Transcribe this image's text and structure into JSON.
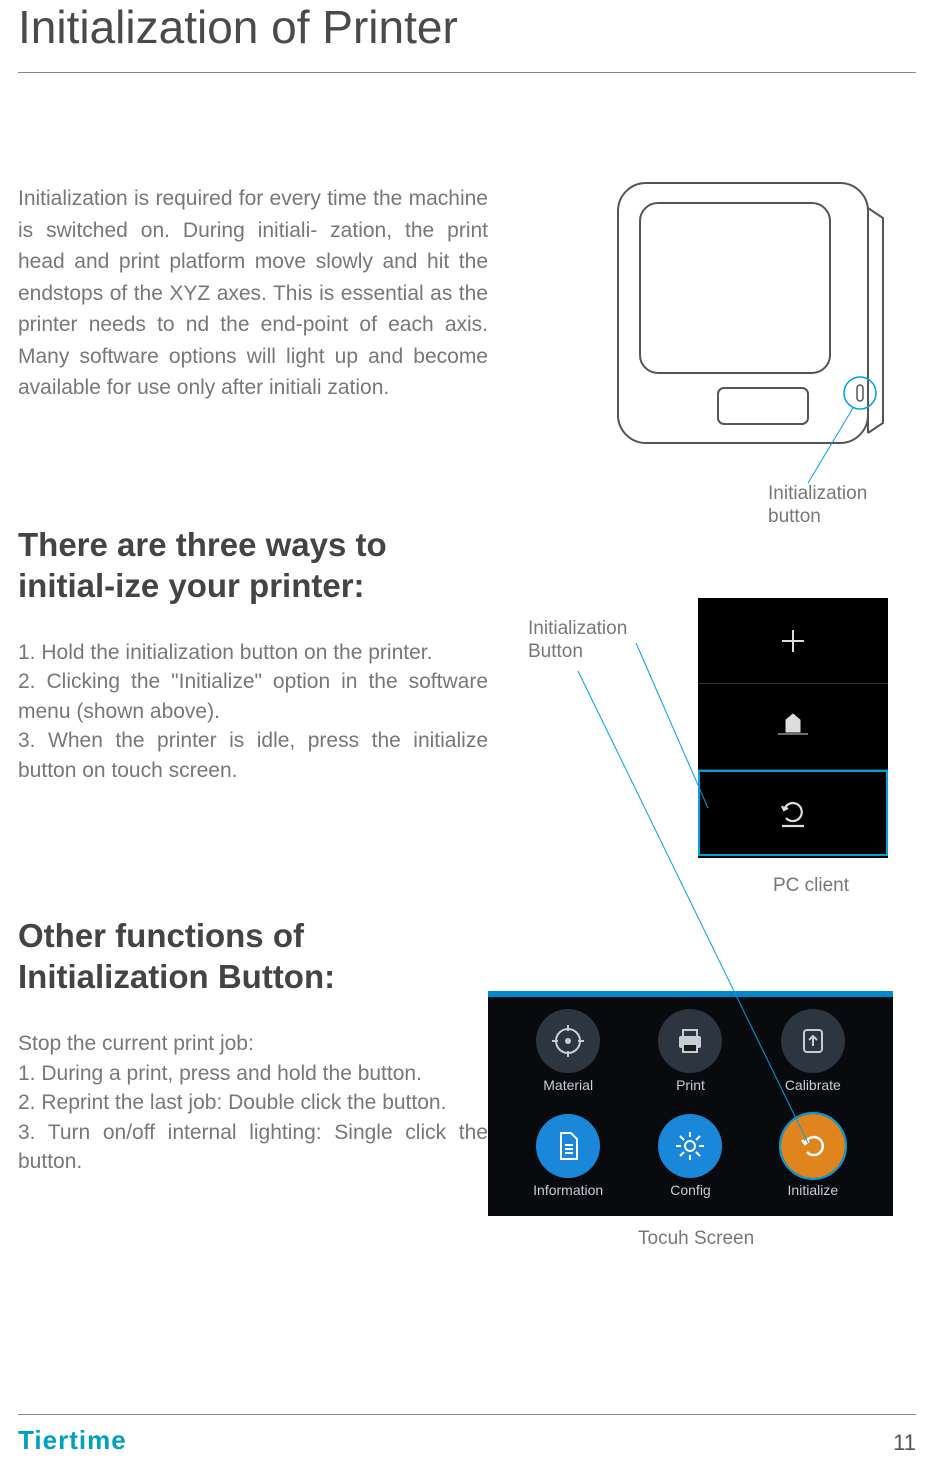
{
  "title": "Initialization of Printer",
  "intro": "Initialization is required for every time the machine is switched on. During initiali- zation, the print head and print platform move slowly and hit the endstops of the XYZ axes. This is essential as the printer needs to  nd the end-point of each axis. Many software options will light up and become available for use only after initiali zation.",
  "heading1": "There are three ways to initial-ize your printer:",
  "body1": "1. Hold the initialization button on the printer.\n2. Clicking the \"Initialize\" option in the software menu (shown above).\n3. When the printer is idle, press the initialize button on touch screen.",
  "heading2": "Other functions of Initialization Button:",
  "body2": "Stop the current print job:\n1. During a print, press and hold the button.\n2. Reprint the last job: Double click the button.\n3. Turn on/off internal lighting: Single click the button.",
  "labels": {
    "init_button_top": "Initialization button",
    "init_button_left": "Initialization Button",
    "pc_client": "PC client",
    "touch_screen": "Tocuh Screen"
  },
  "touch_items": [
    {
      "label": "Material",
      "icon": "target"
    },
    {
      "label": "Print",
      "icon": "printer"
    },
    {
      "label": "Calibrate",
      "icon": "calibrate"
    },
    {
      "label": "Information",
      "icon": "document",
      "color": "blue"
    },
    {
      "label": "Config",
      "icon": "gear",
      "color": "blue"
    },
    {
      "label": "Initialize",
      "icon": "refresh",
      "color": "orange"
    }
  ],
  "footer": {
    "brand": "Tiertime",
    "page": "11"
  }
}
